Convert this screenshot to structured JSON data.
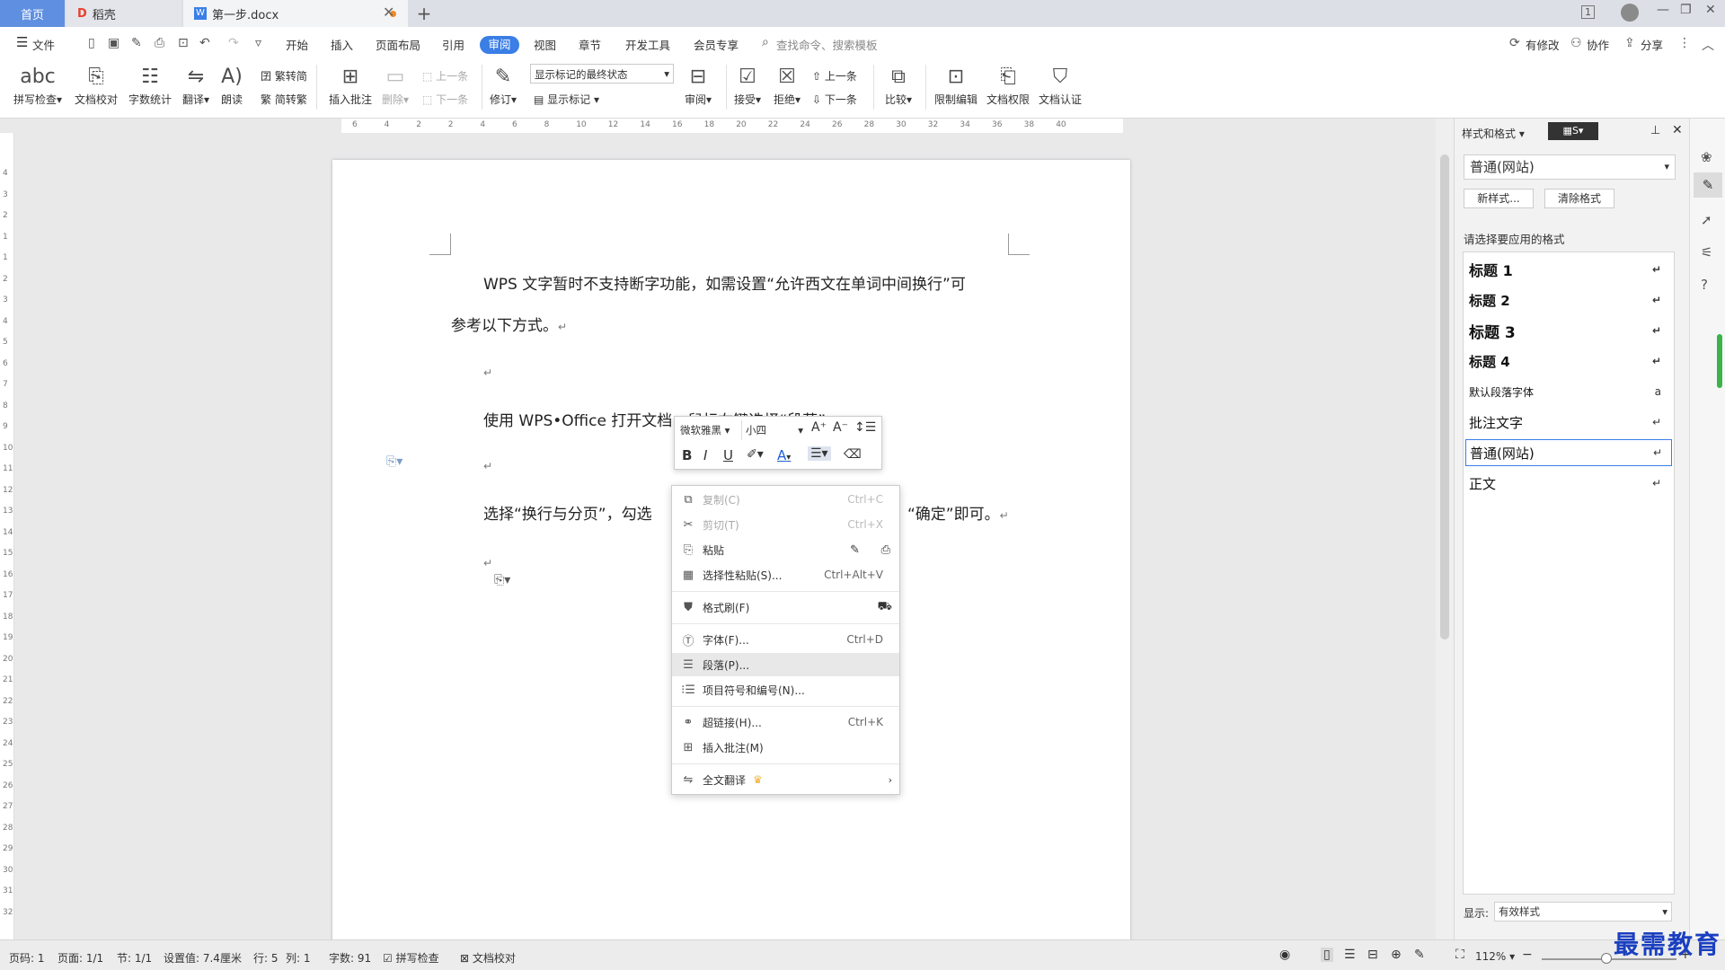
{
  "titlebar": {
    "tab_home": "首页",
    "tab_daoke": "稻壳",
    "tab_doc": "第一步.docx",
    "page_indicator": "1"
  },
  "menu": {
    "file": "文件",
    "items": [
      "开始",
      "插入",
      "页面布局",
      "引用",
      "审阅",
      "视图",
      "章节",
      "开发工具",
      "会员专享"
    ],
    "active": "审阅",
    "search_placeholder": "查找命令、搜索模板",
    "right": {
      "changes": "有修改",
      "collab": "协作",
      "share": "分享"
    }
  },
  "ribbon": {
    "spell": "拼写检查",
    "doc_check": "文档校对",
    "word_count": "字数统计",
    "translate": "翻译",
    "read": "朗读",
    "to_trad": "繁转简",
    "to_simp": "简转繁",
    "insert_comment": "插入批注",
    "delete": "删除",
    "prev": "上一条",
    "next": "下一条",
    "revise": "修订",
    "markup_state": "显示标记的最终状态",
    "show_markup": "显示标记",
    "review": "审阅",
    "accept": "接受",
    "reject": "拒绝",
    "prev2": "上一条",
    "next2": "下一条",
    "compare": "比较",
    "restrict": "限制编辑",
    "permission": "文档权限",
    "certify": "文档认证"
  },
  "ruler": {
    "h_ticks": [
      "6",
      "4",
      "2",
      "2",
      "4",
      "6",
      "8",
      "10",
      "12",
      "14",
      "16",
      "18",
      "20",
      "22",
      "24",
      "26",
      "28",
      "30",
      "32",
      "34",
      "36",
      "38",
      "40"
    ],
    "v_ticks": [
      "4",
      "3",
      "2",
      "1",
      "1",
      "2",
      "3",
      "4",
      "5",
      "6",
      "7",
      "8",
      "9",
      "10",
      "11",
      "12",
      "13",
      "14",
      "15",
      "16",
      "17",
      "18",
      "19",
      "20",
      "21",
      "22",
      "23",
      "24",
      "25",
      "26",
      "27",
      "28",
      "29",
      "30",
      "31",
      "32"
    ]
  },
  "document": {
    "line1": "WPS 文字暂时不支持断字功能，如需设置“允许西文在单词中间换行”可",
    "line2": "参考以下方式。",
    "line3": "使用 WPS•Office 打开文档，鼠标右键选择“段落”",
    "line4a": "选择“换行与分页”，勾选",
    "line4b": "“确定”即可。",
    "para_mark": "↵"
  },
  "minibar": {
    "font": "微软雅黑",
    "size": "小四"
  },
  "context_menu": [
    {
      "icon": "copy-icon",
      "label": "复制(C)",
      "shortcut": "Ctrl+C",
      "disabled": true
    },
    {
      "icon": "cut-icon",
      "label": "剪切(T)",
      "shortcut": "Ctrl+X",
      "disabled": true
    },
    {
      "icon": "paste-icon",
      "label": "粘贴",
      "shortcut": "",
      "disabled": false
    },
    {
      "icon": "paste-special-icon",
      "label": "选择性粘贴(S)...",
      "shortcut": "Ctrl+Alt+V",
      "disabled": false
    },
    {
      "icon": "format-painter-icon",
      "label": "格式刷(F)",
      "shortcut": "",
      "disabled": false
    },
    {
      "icon": "font-icon",
      "label": "字体(F)...",
      "shortcut": "Ctrl+D",
      "disabled": false
    },
    {
      "icon": "paragraph-icon",
      "label": "段落(P)...",
      "shortcut": "",
      "disabled": false,
      "highlighted": true
    },
    {
      "icon": "bullets-icon",
      "label": "项目符号和编号(N)...",
      "shortcut": "",
      "disabled": false
    },
    {
      "icon": "link-icon",
      "label": "超链接(H)...",
      "shortcut": "Ctrl+K",
      "disabled": false
    },
    {
      "icon": "comment-icon",
      "label": "插入批注(M)",
      "shortcut": "",
      "disabled": false
    },
    {
      "icon": "translate-icon",
      "label": "全文翻译",
      "shortcut": "",
      "disabled": false
    }
  ],
  "styles_panel": {
    "title": "样式和格式",
    "current": "普通(网站)",
    "new_style": "新样式...",
    "clear_format": "清除格式",
    "prompt": "请选择要应用的格式",
    "styles": [
      "标题 1",
      "标题 2",
      "标题 3",
      "标题 4",
      "默认段落字体",
      "批注文字",
      "普通(网站)",
      "正文"
    ],
    "show_label": "显示:",
    "show_value": "有效样式"
  },
  "statusbar": {
    "page_code": "页码: 1",
    "pages": "页面: 1/1",
    "section": "节: 1/1",
    "setting": "设置值: 7.4厘米",
    "row": "行: 5",
    "col": "列: 1",
    "words": "字数: 91",
    "spell": "拼写检查",
    "proof": "文档校对",
    "zoom": "112%"
  },
  "watermark": "最需教育"
}
